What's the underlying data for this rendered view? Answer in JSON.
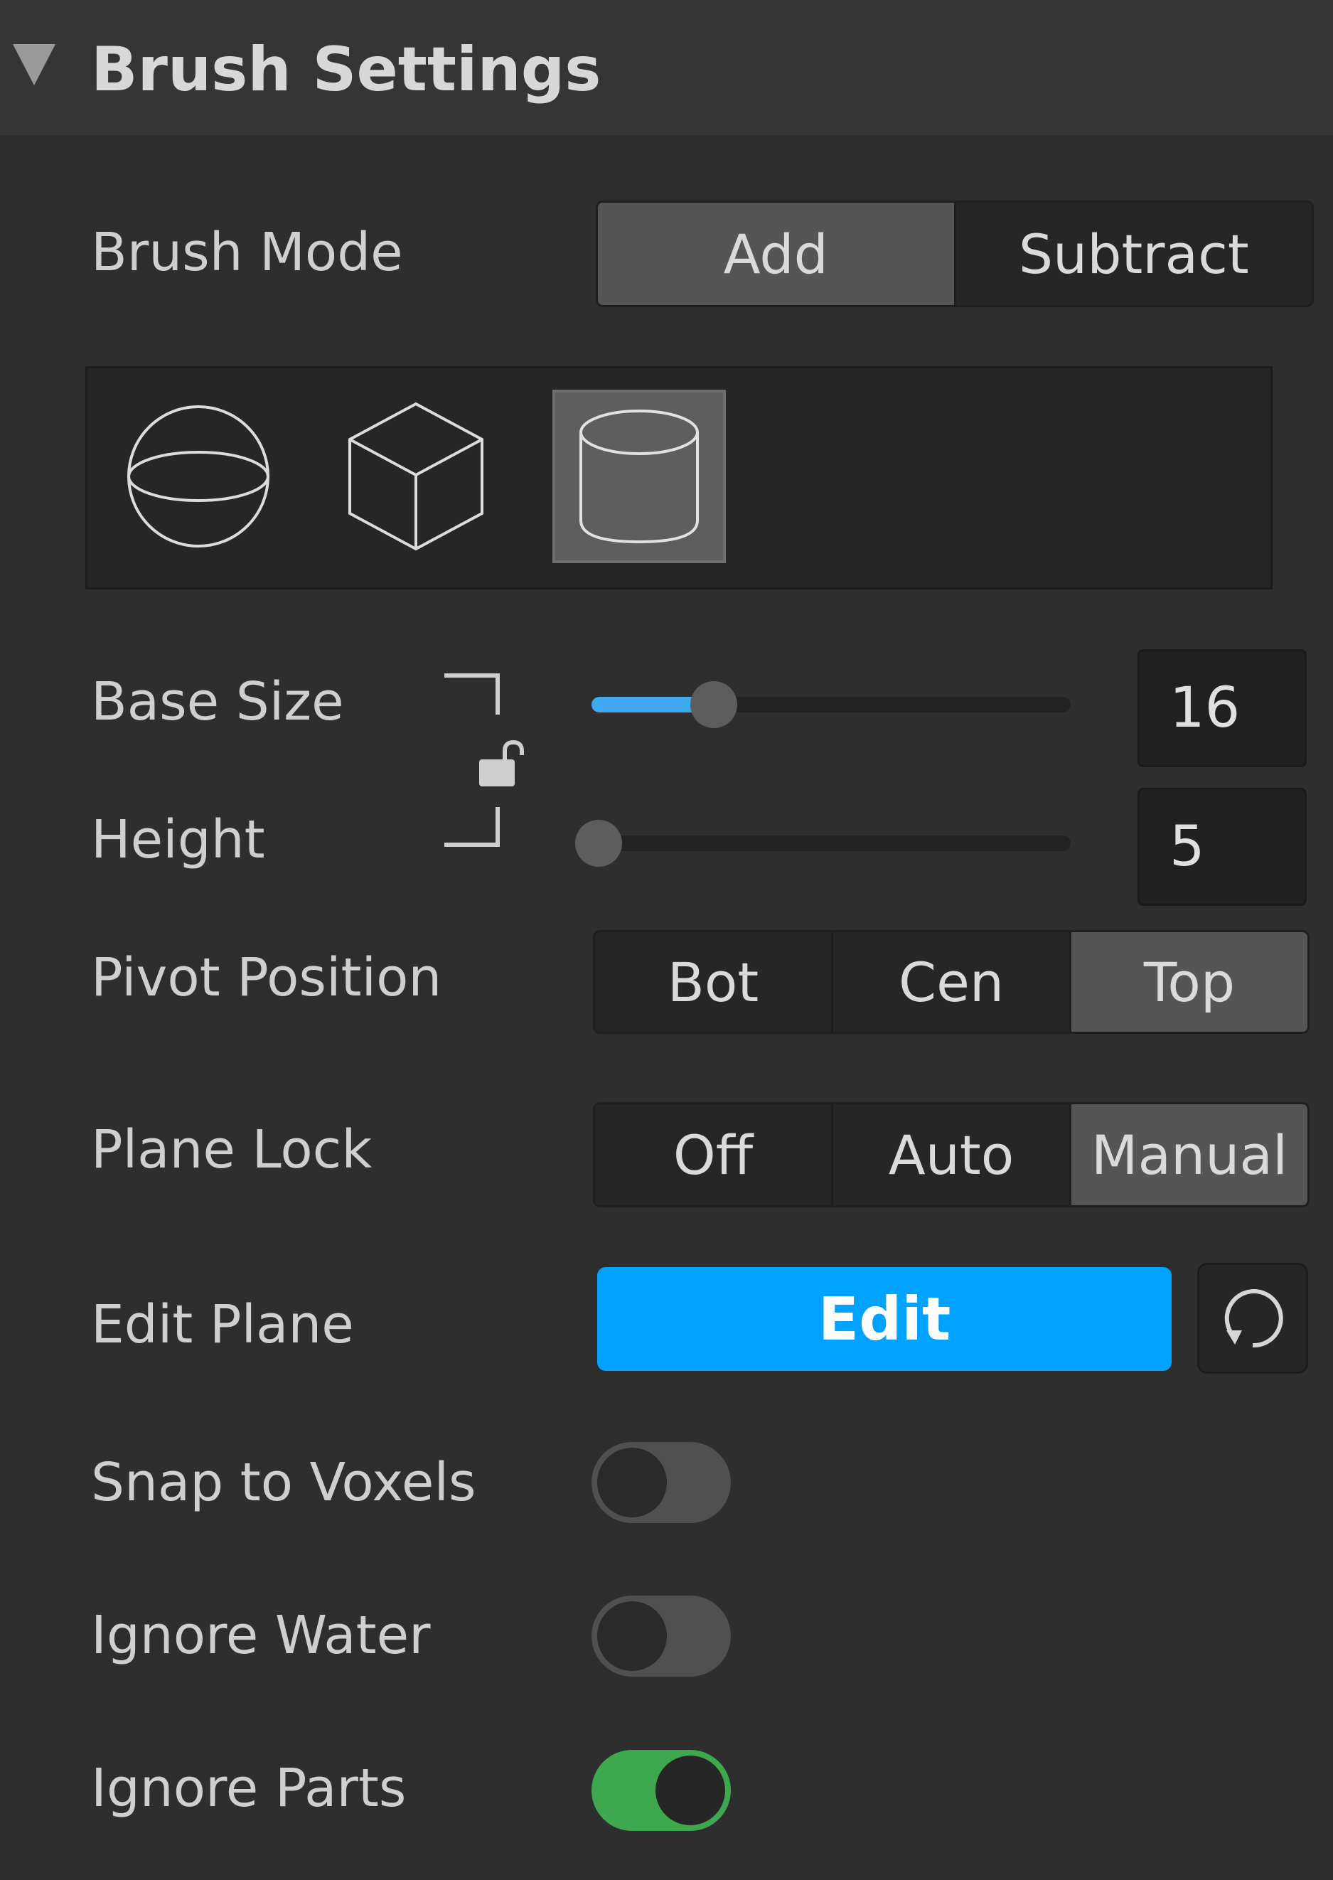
{
  "section": {
    "title": "Brush Settings"
  },
  "brush_mode": {
    "label": "Brush Mode",
    "options": [
      "Add",
      "Subtract"
    ],
    "selected": "Add"
  },
  "brush_shapes": {
    "options": [
      "sphere-icon",
      "cube-icon",
      "cylinder-icon"
    ],
    "selected": "cylinder-icon"
  },
  "base_size": {
    "label": "Base Size",
    "value": "16",
    "fraction": 0.24
  },
  "height": {
    "label": "Height",
    "value": "5",
    "fraction": 0.0
  },
  "size_lock": {
    "icon": "unlock-icon",
    "locked": false
  },
  "pivot_position": {
    "label": "Pivot Position",
    "options": [
      "Bot",
      "Cen",
      "Top"
    ],
    "selected": "Top"
  },
  "plane_lock": {
    "label": "Plane Lock",
    "options": [
      "Off",
      "Auto",
      "Manual"
    ],
    "selected": "Manual"
  },
  "edit_plane": {
    "label": "Edit Plane",
    "button": "Edit",
    "reset_icon": "reset-icon"
  },
  "snap_to_voxels": {
    "label": "Snap to Voxels",
    "on": false
  },
  "ignore_water": {
    "label": "Ignore Water",
    "on": false
  },
  "ignore_parts": {
    "label": "Ignore Parts",
    "on": true
  },
  "colors": {
    "accent": "#00a2ff",
    "slider_fill": "#41a9f0",
    "toggle_on": "#3ea84f"
  }
}
